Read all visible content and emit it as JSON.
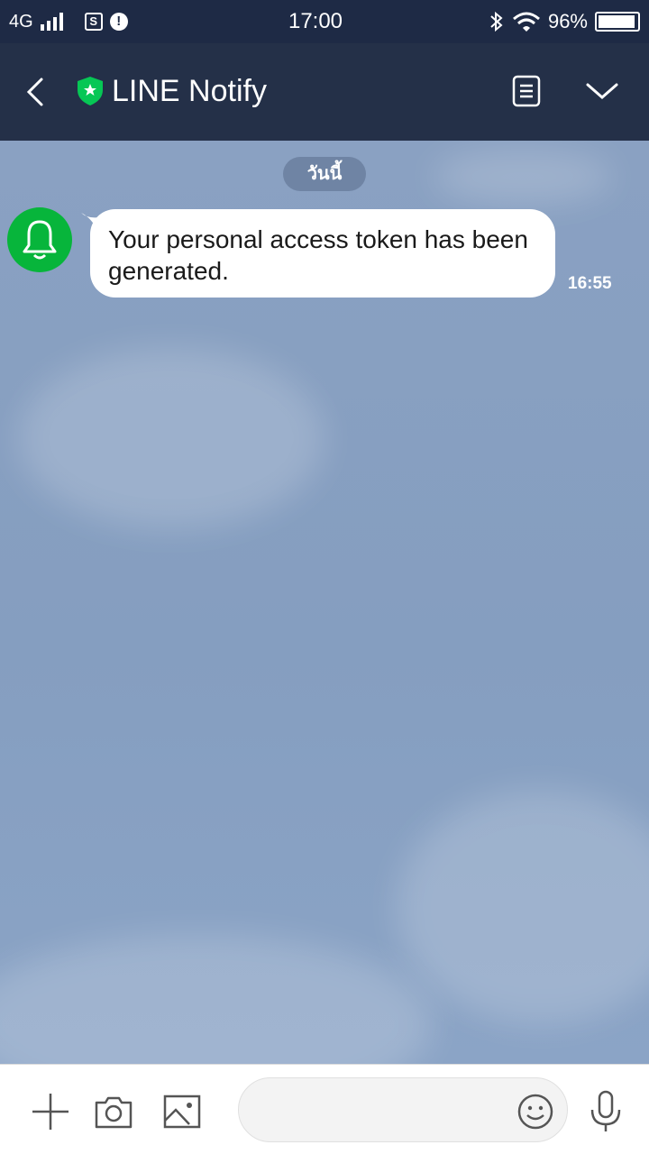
{
  "status_bar": {
    "network": "4G",
    "time": "17:00",
    "battery_text": "96%",
    "battery_level": 0.96
  },
  "header": {
    "title": "LINE Notify"
  },
  "chat": {
    "date_label": "วันนี้",
    "messages": [
      {
        "text": "Your personal access token has been generated.",
        "time": "16:55"
      }
    ]
  },
  "input_bar": {
    "placeholder": ""
  },
  "colors": {
    "status_bar_bg": "#1e2a45",
    "header_bg": "#243048",
    "chat_bg": "#8aa2c3",
    "avatar_green": "#07b53b",
    "shield_green": "#06c755"
  },
  "icons": [
    "back-icon",
    "shield-icon",
    "notes-icon",
    "chevron-down-icon",
    "bell-icon",
    "plus-icon",
    "camera-icon",
    "image-icon",
    "emoji-icon",
    "mic-icon",
    "bluetooth-icon",
    "wifi-icon",
    "battery-icon",
    "signal-icon"
  ]
}
